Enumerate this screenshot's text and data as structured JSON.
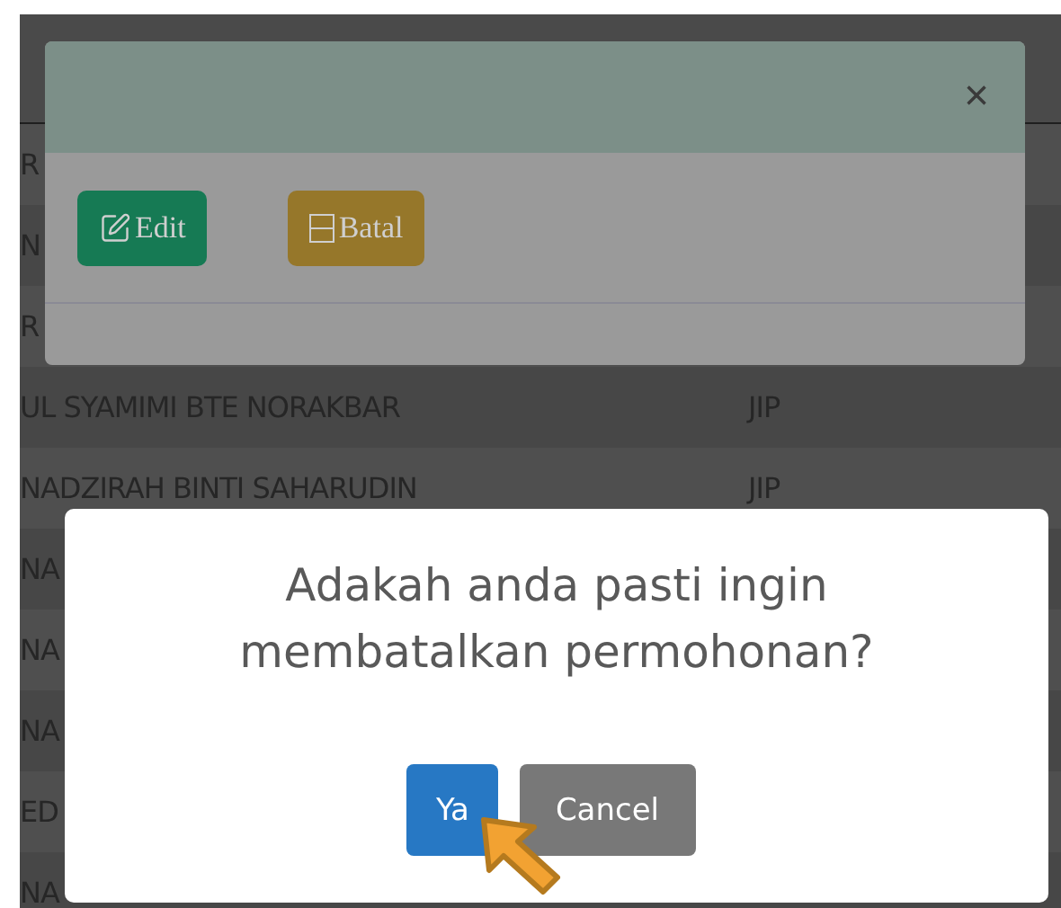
{
  "table": {
    "rows": [
      {
        "column_1": "R"
      },
      {
        "column_1": "N"
      },
      {
        "column_1": "R"
      },
      {
        "column_1": "UL SYAMIMI BTE NORAKBAR",
        "column_2": "JIP"
      },
      {
        "column_1": "NADZIRAH BINTI SAHARUDIN",
        "column_2": "JIP"
      },
      {
        "column_1": "NA"
      },
      {
        "column_1": "NA"
      },
      {
        "column_1": "NA"
      },
      {
        "column_1": "ED"
      },
      {
        "column_1": "NA"
      }
    ]
  },
  "back_modal": {
    "close": "×",
    "buttons": [
      {
        "label": "Edit",
        "kind": "edit"
      },
      {
        "label": "Batal",
        "kind": "cancel"
      }
    ]
  },
  "confirm_dialog": {
    "message": "Adakah anda pasti ingin membatalkan permohonan?",
    "buttons": [
      {
        "label": "Ya",
        "kind": "primary"
      },
      {
        "label": "Cancel",
        "kind": "secondary"
      }
    ]
  }
}
